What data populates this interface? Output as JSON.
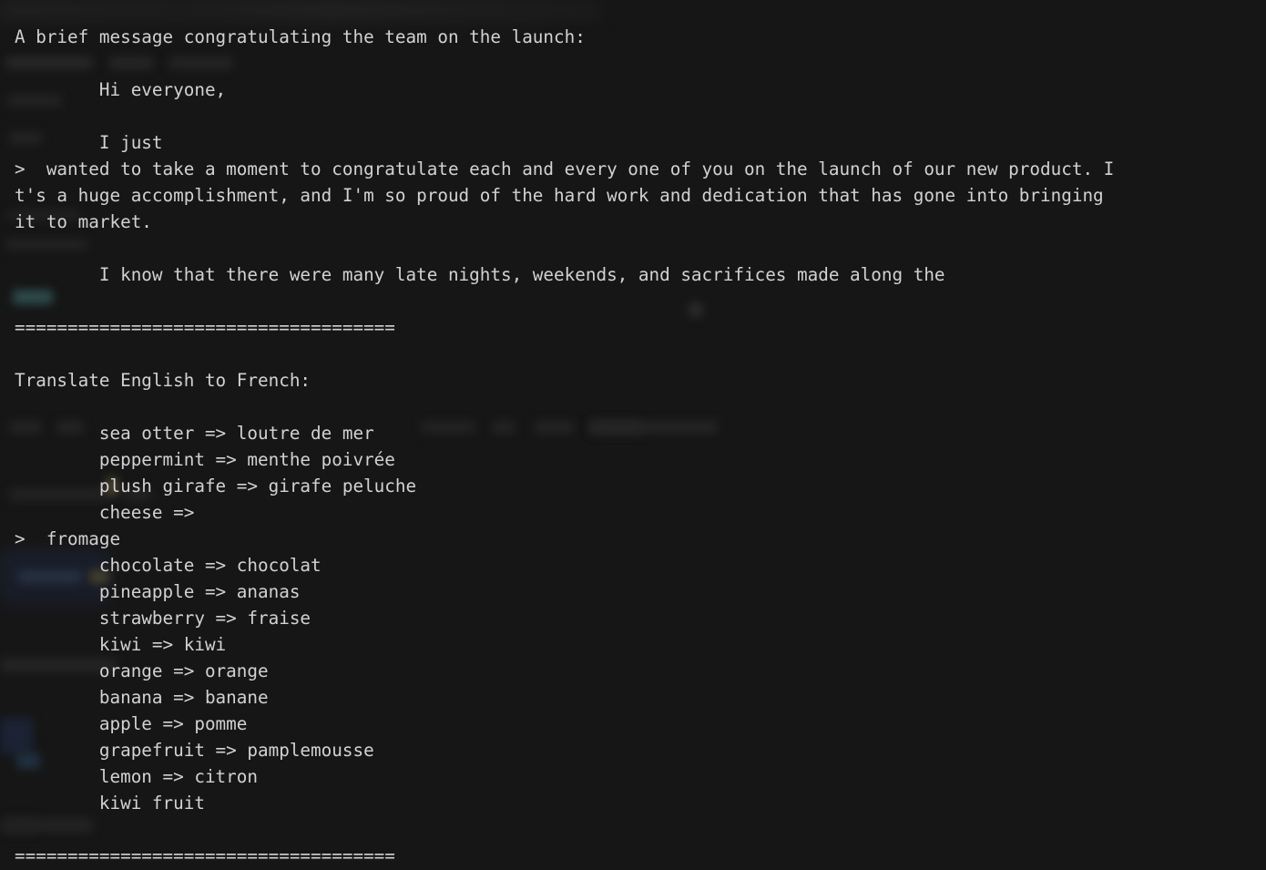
{
  "terminal": {
    "title": "Terminal",
    "background_color": "#161616",
    "text_color": "#d2d2d2",
    "prompt_symbol": ">",
    "separator": "====================================",
    "lines": [
      {
        "name": "task-prompt",
        "text": "A brief message congratulating the team on the launch:"
      },
      {
        "name": "blank",
        "text": ""
      },
      {
        "name": "greeting",
        "text": "        Hi everyone,"
      },
      {
        "name": "blank",
        "text": ""
      },
      {
        "name": "body-start",
        "text": "        I just"
      },
      {
        "name": "prompt-continuation",
        "text": ">  wanted to take a moment to congratulate each and every one of you on the launch of our new product. I"
      },
      {
        "name": "body-wrap-1",
        "text": "t's a huge accomplishment, and I'm so proud of the hard work and dedication that has gone into bringing"
      },
      {
        "name": "body-wrap-2",
        "text": "it to market."
      },
      {
        "name": "blank",
        "text": ""
      },
      {
        "name": "body-paragraph-2",
        "text": "        I know that there were many late nights, weekends, and sacrifices made along the"
      },
      {
        "name": "blank",
        "text": ""
      },
      {
        "name": "separator-top",
        "text": "===================================="
      },
      {
        "name": "blank",
        "text": ""
      },
      {
        "name": "translate-heading",
        "text": "Translate English to French:"
      },
      {
        "name": "blank",
        "text": ""
      },
      {
        "name": "pair-sea-otter",
        "text": "        sea otter => loutre de mer"
      },
      {
        "name": "pair-peppermint",
        "text": "        peppermint => menthe poivrée"
      },
      {
        "name": "pair-plush-girafe",
        "text": "        plush girafe => girafe peluche"
      },
      {
        "name": "pair-cheese",
        "text": "        cheese =>"
      },
      {
        "name": "prompt-fromage",
        "text": ">  fromage"
      },
      {
        "name": "pair-chocolate",
        "text": "        chocolate => chocolat"
      },
      {
        "name": "pair-pineapple",
        "text": "        pineapple => ananas"
      },
      {
        "name": "pair-strawberry",
        "text": "        strawberry => fraise"
      },
      {
        "name": "pair-kiwi",
        "text": "        kiwi => kiwi"
      },
      {
        "name": "pair-orange",
        "text": "        orange => orange"
      },
      {
        "name": "pair-banana",
        "text": "        banana => banane"
      },
      {
        "name": "pair-apple",
        "text": "        apple => pomme"
      },
      {
        "name": "pair-grapefruit",
        "text": "        grapefruit => pamplemousse"
      },
      {
        "name": "pair-lemon",
        "text": "        lemon => citron"
      },
      {
        "name": "pair-kiwi-fruit",
        "text": "        kiwi fruit"
      },
      {
        "name": "blank",
        "text": ""
      },
      {
        "name": "separator-bottom",
        "text": "===================================="
      }
    ],
    "translation_pairs": [
      {
        "source": "sea otter",
        "target": "loutre de mer"
      },
      {
        "source": "peppermint",
        "target": "menthe poivrée"
      },
      {
        "source": "plush girafe",
        "target": "girafe peluche"
      },
      {
        "source": "cheese",
        "target": "fromage"
      },
      {
        "source": "chocolate",
        "target": "chocolat"
      },
      {
        "source": "pineapple",
        "target": "ananas"
      },
      {
        "source": "strawberry",
        "target": "fraise"
      },
      {
        "source": "kiwi",
        "target": "kiwi"
      },
      {
        "source": "orange",
        "target": "orange"
      },
      {
        "source": "banana",
        "target": "banane"
      },
      {
        "source": "apple",
        "target": "pomme"
      },
      {
        "source": "grapefruit",
        "target": "pamplemousse"
      },
      {
        "source": "lemon",
        "target": "citron"
      },
      {
        "source": "kiwi fruit",
        "target": ""
      }
    ]
  },
  "ghost_layer": {
    "description": "blurred underlying window showing faintly through the terminal background",
    "tint_color": "#1a2030"
  }
}
